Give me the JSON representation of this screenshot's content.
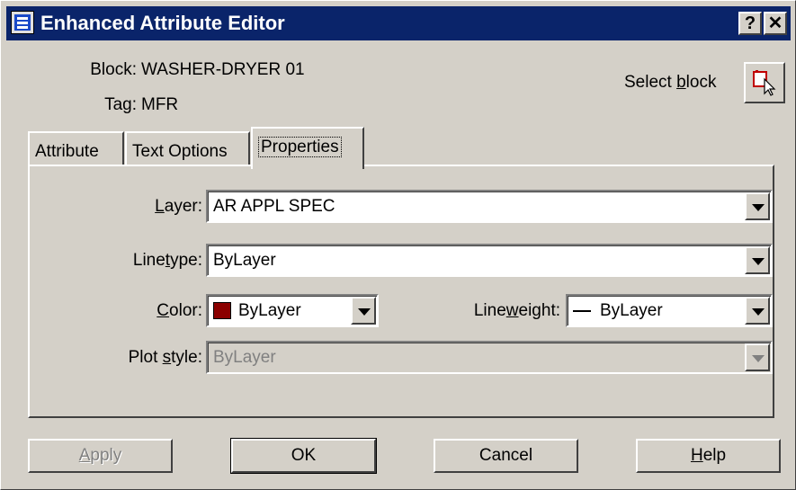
{
  "window": {
    "title": "Enhanced Attribute Editor",
    "help_glyph": "?",
    "close_glyph": "✕"
  },
  "header": {
    "block_label": "Block:",
    "block_value": "WASHER-DRYER 01",
    "tag_label": "Tag:",
    "tag_value": "MFR",
    "select_block_pre": "Select ",
    "select_block_accel": "b",
    "select_block_post": "lock"
  },
  "tabs": [
    {
      "label": "Attribute",
      "active": false
    },
    {
      "label": "Text Options",
      "active": false
    },
    {
      "label": "Properties",
      "active": true
    }
  ],
  "properties": {
    "layer": {
      "pre": "",
      "accel": "L",
      "post": "ayer:",
      "value": "AR APPL SPEC"
    },
    "linetype": {
      "pre": "Line",
      "accel": "t",
      "post": "ype:",
      "value": "ByLayer"
    },
    "color": {
      "pre": "",
      "accel": "C",
      "post": "olor:",
      "value": "ByLayer",
      "swatch": "#8b0000"
    },
    "lineweight": {
      "pre": "Line",
      "accel": "w",
      "post": "eight:",
      "value": "ByLayer"
    },
    "plot_style": {
      "pre": "Plot ",
      "accel": "s",
      "post": "tyle:",
      "value": "ByLayer",
      "disabled": true
    }
  },
  "buttons": {
    "apply": {
      "pre": "",
      "accel": "A",
      "post": "pply",
      "disabled": true
    },
    "ok": {
      "label": "OK"
    },
    "cancel": {
      "label": "Cancel"
    },
    "help": {
      "pre": "",
      "accel": "H",
      "post": "elp"
    }
  }
}
